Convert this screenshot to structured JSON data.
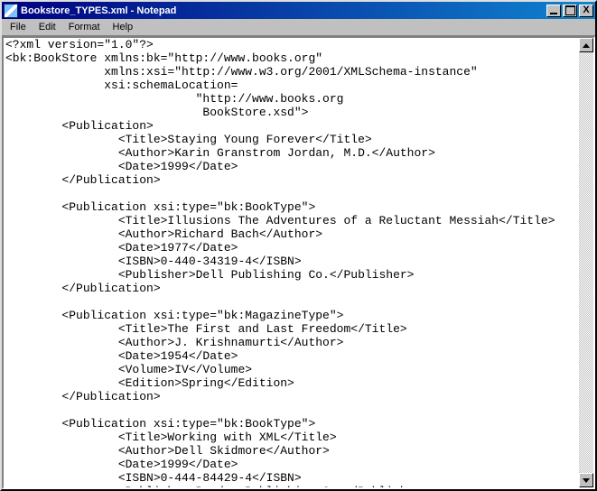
{
  "window": {
    "title": "Bookstore_TYPES.xml - Notepad"
  },
  "menu": {
    "file": "File",
    "edit": "Edit",
    "format": "Format",
    "help": "Help"
  },
  "controls": {
    "close": "X"
  },
  "editor": {
    "content": "<?xml version=\"1.0\"?>\n<bk:BookStore xmlns:bk=\"http://www.books.org\"\n              xmlns:xsi=\"http://www.w3.org/2001/XMLSchema-instance\"\n              xsi:schemaLocation=\n                           \"http://www.books.org\n                            BookStore.xsd\">\n        <Publication>\n                <Title>Staying Young Forever</Title>\n                <Author>Karin Granstrom Jordan, M.D.</Author>\n                <Date>1999</Date>\n        </Publication>\n\n        <Publication xsi:type=\"bk:BookType\">\n                <Title>Illusions The Adventures of a Reluctant Messiah</Title>\n                <Author>Richard Bach</Author>\n                <Date>1977</Date>\n                <ISBN>0-440-34319-4</ISBN>\n                <Publisher>Dell Publishing Co.</Publisher>\n        </Publication>\n\n        <Publication xsi:type=\"bk:MagazineType\">\n                <Title>The First and Last Freedom</Title>\n                <Author>J. Krishnamurti</Author>\n                <Date>1954</Date>\n                <Volume>IV</Volume>\n                <Edition>Spring</Edition>\n        </Publication>\n\n        <Publication xsi:type=\"bk:BookType\">\n                <Title>Working with XML</Title>\n                <Author>Dell Skidmore</Author>\n                <Date>1999</Date>\n                <ISBN>0-444-84429-4</ISBN>\n                <Publisher>Purdam Publishing Co.</Publisher>\n        </Publication>\n\n</bk:BookStore>"
  }
}
